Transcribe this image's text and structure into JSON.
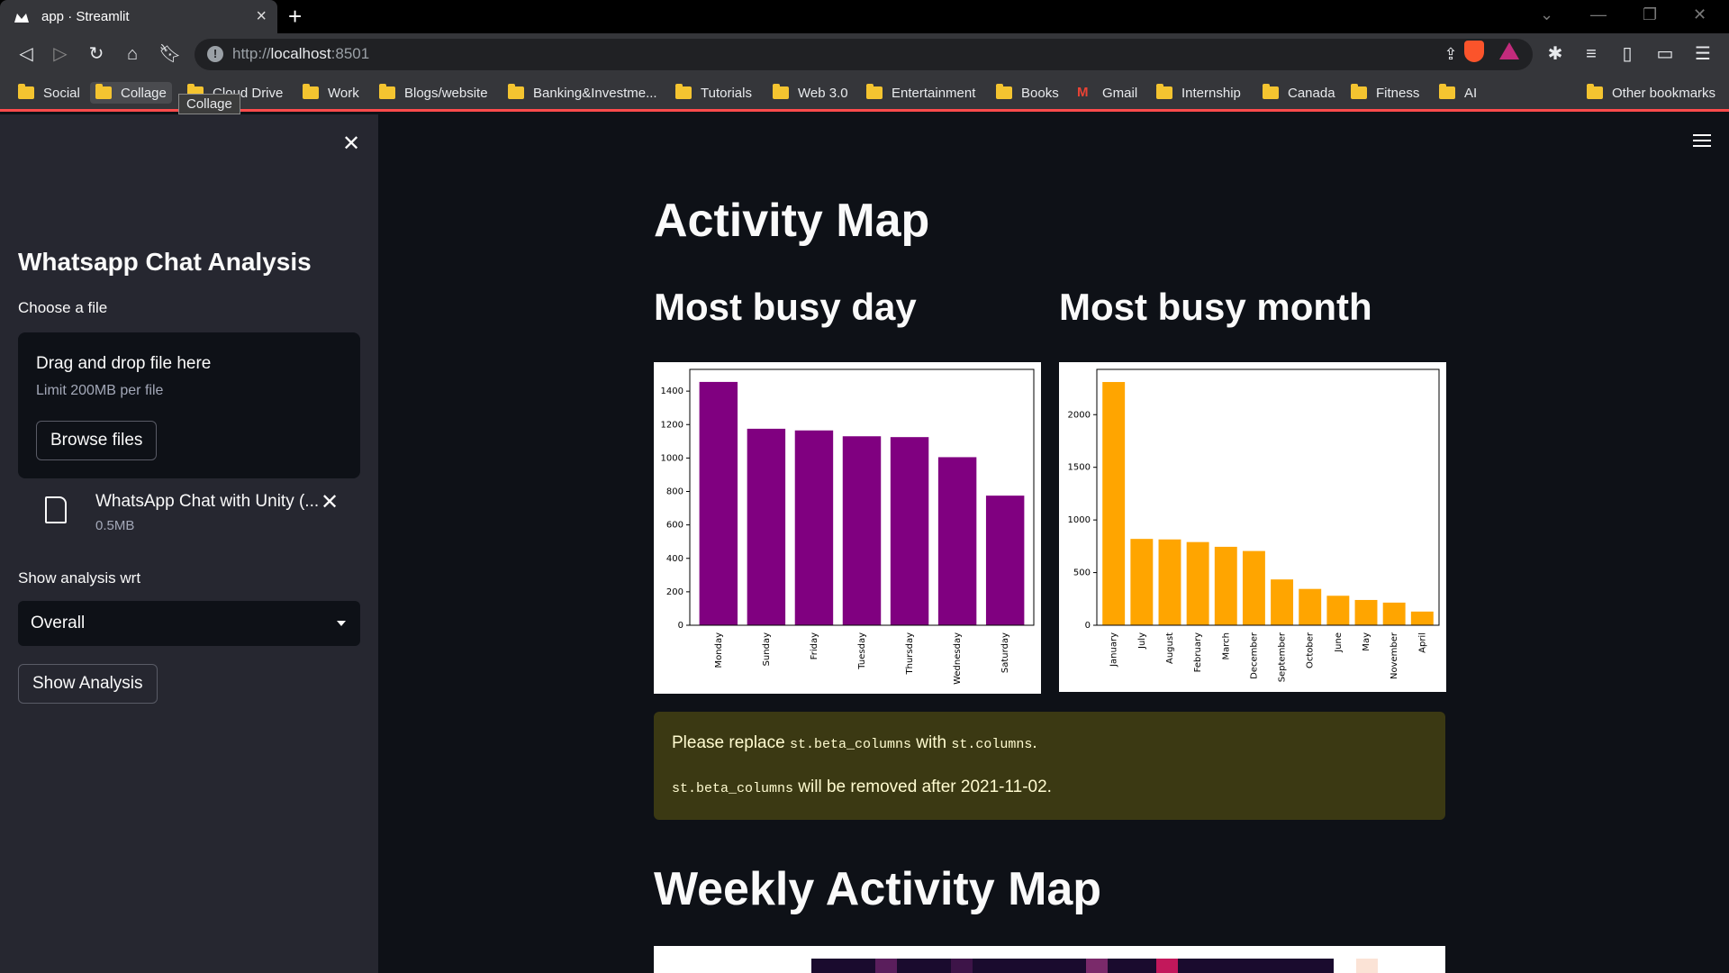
{
  "browser": {
    "tab_title": "app · Streamlit",
    "url_prefix": "http://",
    "url_host": "localhost",
    "url_port": ":8501",
    "bookmarks": [
      "Social",
      "Collage",
      "Cloud Drive",
      "Work",
      "Blogs/website",
      "Banking&Investme...",
      "Tutorials",
      "Web 3.0",
      "Entertainment",
      "Books",
      "Gmail",
      "Internship",
      "Canada",
      "Fitness",
      "AI",
      "Other bookmarks"
    ],
    "tooltip": "Collage"
  },
  "sidebar": {
    "title": "Whatsapp Chat Analysis",
    "choose_file_label": "Choose a file",
    "dropzone_title": "Drag and drop file here",
    "dropzone_limit": "Limit 200MB per file",
    "browse_button": "Browse files",
    "file_name": "WhatsApp Chat with Unity (...",
    "file_size": "0.5MB",
    "analysis_label": "Show analysis wrt",
    "select_value": "Overall",
    "show_button": "Show Analysis"
  },
  "main": {
    "activity_title": "Activity Map",
    "busy_day_title": "Most busy day",
    "busy_month_title": "Most busy month",
    "warning_line1_a": "Please replace ",
    "warning_code1": "st.beta_columns",
    "warning_line1_b": " with ",
    "warning_code2": "st.columns",
    "warning_line1_c": ".",
    "warning_code3": "st.beta_columns",
    "warning_line2": " will be removed after 2021-11-02.",
    "weekly_title": "Weekly Activity Map"
  },
  "chart_data": [
    {
      "type": "bar",
      "title": "",
      "categories": [
        "Monday",
        "Sunday",
        "Friday",
        "Tuesday",
        "Thursday",
        "Wednesday",
        "Saturday"
      ],
      "values": [
        1455,
        1175,
        1165,
        1130,
        1125,
        1005,
        775
      ],
      "ylim": [
        0,
        1530
      ],
      "yticks": [
        0,
        200,
        400,
        600,
        800,
        1000,
        1200,
        1400
      ],
      "color": "#800080"
    },
    {
      "type": "bar",
      "title": "",
      "categories": [
        "January",
        "July",
        "August",
        "February",
        "March",
        "December",
        "September",
        "October",
        "June",
        "May",
        "November",
        "April"
      ],
      "values": [
        2310,
        820,
        815,
        790,
        745,
        705,
        435,
        345,
        280,
        240,
        215,
        130
      ],
      "ylim": [
        0,
        2430
      ],
      "yticks": [
        0,
        500,
        1000,
        1500,
        2000
      ],
      "color": "#FFA500"
    }
  ]
}
